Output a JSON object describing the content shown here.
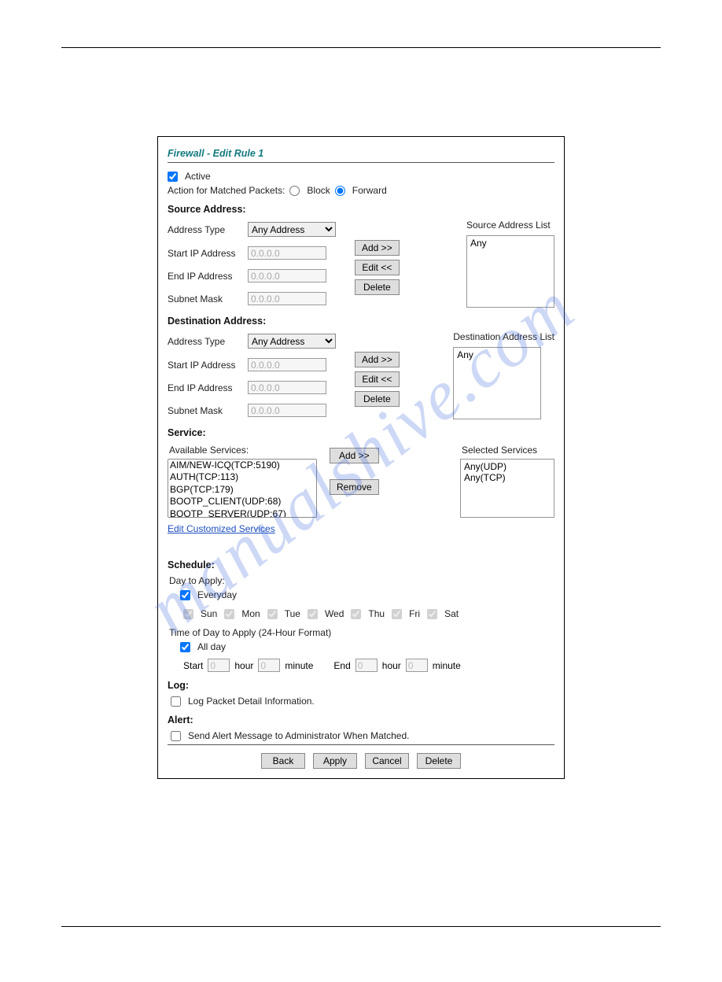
{
  "title": "Firewall - Edit Rule 1",
  "active": {
    "label": "Active",
    "checked": true
  },
  "action_label": "Action for Matched Packets:",
  "action_options": {
    "block": "Block",
    "forward": "Forward",
    "selected": "forward"
  },
  "source": {
    "heading": "Source Address:",
    "list_heading": "Source Address List",
    "addr_type_label": "Address Type",
    "addr_type_value": "Any Address",
    "start_ip_label": "Start IP Address",
    "start_ip_value": "0.0.0.0",
    "end_ip_label": "End IP Address",
    "end_ip_value": "0.0.0.0",
    "subnet_label": "Subnet Mask",
    "subnet_value": "0.0.0.0",
    "btn_add": "Add >>",
    "btn_edit": "Edit <<",
    "btn_delete": "Delete",
    "list_item": "Any"
  },
  "dest": {
    "heading": "Destination Address:",
    "list_heading": "Destination Address List",
    "addr_type_label": "Address Type",
    "addr_type_value": "Any Address",
    "start_ip_label": "Start IP Address",
    "start_ip_value": "0.0.0.0",
    "end_ip_label": "End IP Address",
    "end_ip_value": "0.0.0.0",
    "subnet_label": "Subnet Mask",
    "subnet_value": "0.0.0.0",
    "btn_add": "Add >>",
    "btn_edit": "Edit <<",
    "btn_delete": "Delete",
    "list_item": "Any"
  },
  "service": {
    "heading": "Service:",
    "available_label": "Available Services:",
    "selected_label": "Selected Services",
    "available": [
      "AIM/NEW-ICQ(TCP:5190)",
      "AUTH(TCP:113)",
      "BGP(TCP:179)",
      "BOOTP_CLIENT(UDP:68)",
      "BOOTP_SERVER(UDP:67)"
    ],
    "selected": [
      "Any(UDP)",
      "Any(TCP)"
    ],
    "btn_add": "Add >>",
    "btn_remove": "Remove",
    "edit_link": "Edit Customized Services"
  },
  "schedule": {
    "heading": "Schedule:",
    "day_label": "Day to Apply:",
    "everyday_label": "Everyday",
    "days": [
      "Sun",
      "Mon",
      "Tue",
      "Wed",
      "Thu",
      "Fri",
      "Sat"
    ],
    "time_label": "Time of Day to Apply   (24-Hour Format)",
    "allday_label": "All day",
    "start_label": "Start",
    "end_label": "End",
    "hour_label": "hour",
    "minute_label": "minute",
    "start_hour": "0",
    "start_minute": "0",
    "end_hour": "0",
    "end_minute": "0"
  },
  "log": {
    "heading": "Log:",
    "label": "Log Packet Detail Information."
  },
  "alert": {
    "heading": "Alert:",
    "label": "Send Alert Message to Administrator When Matched."
  },
  "footer": {
    "back": "Back",
    "apply": "Apply",
    "cancel": "Cancel",
    "delete": "Delete"
  },
  "watermark": "manualshive.com"
}
